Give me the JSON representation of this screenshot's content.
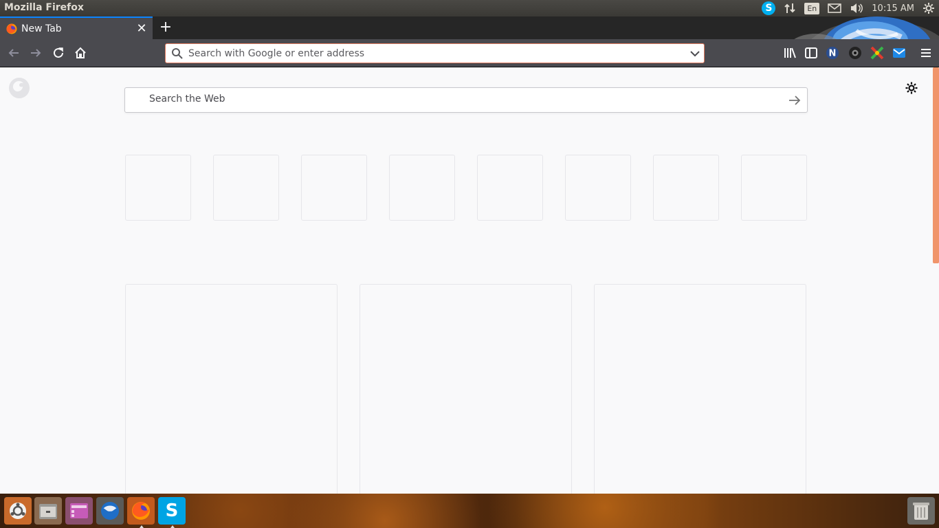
{
  "window": {
    "title": "Mozilla Firefox"
  },
  "system_tray": {
    "keyboard_layout": "En",
    "clock": "10:15 AM",
    "skype_badge": "S"
  },
  "tabs": [
    {
      "title": "New Tab",
      "active": true
    }
  ],
  "navbar": {
    "urlbar_placeholder": "Search with Google or enter address"
  },
  "toolbar_icons": [
    "library-icon",
    "sidebar-icon",
    "extension-n-icon",
    "camera-extension-icon",
    "colorful-extension-icon",
    "mail-extension-icon",
    "menu-icon"
  ],
  "newtab": {
    "search_placeholder": "Search the Web",
    "top_sites_count": 8,
    "highlight_cards_count": 3
  },
  "launcher": {
    "items": [
      "ubuntu-dash-icon",
      "files-icon",
      "workspaces-icon",
      "thunderbird-icon",
      "firefox-icon",
      "skype-icon"
    ],
    "skype_label": "S",
    "trash": "trash-icon"
  },
  "colors": {
    "tab_accent": "#0a84ff",
    "urlbar_border": "#e07a5f",
    "scroll_thumb": "#f0956b",
    "skype_blue": "#00aff0"
  }
}
